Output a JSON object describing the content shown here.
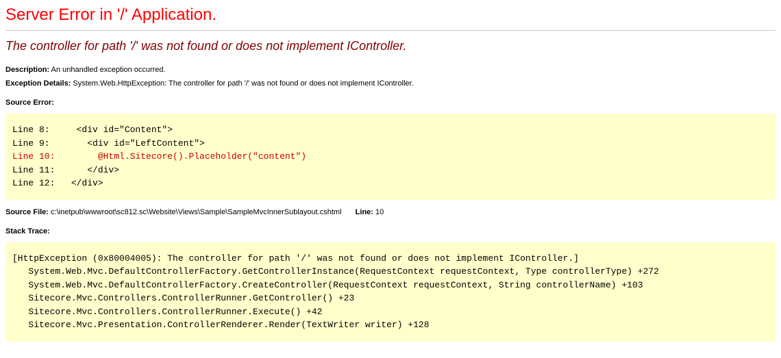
{
  "title": "Server Error in '/' Application.",
  "subtitle": "The controller for path '/' was not found or does not implement IController.",
  "description": {
    "label": "Description:",
    "text": "An unhandled exception occurred."
  },
  "exceptionDetails": {
    "label": "Exception Details:",
    "text": "System.Web.HttpException: The controller for path '/' was not found or does not implement IController."
  },
  "sourceError": {
    "label": "Source Error:",
    "lines": [
      "Line 8:     <div id=\"Content\">",
      "Line 9:       <div id=\"LeftContent\">",
      "Line 10:        @Html.Sitecore().Placeholder(\"content\")",
      "Line 11:      </div>",
      "Line 12:   </div>"
    ],
    "highlightIndex": 2
  },
  "sourceFile": {
    "label": "Source File:",
    "path": "c:\\inetpub\\wwwroot\\sc812.sc\\Website\\Views\\Sample\\SampleMvcInnerSublayout.cshtml",
    "lineLabel": "Line:",
    "lineNumber": "10"
  },
  "stackTrace": {
    "label": "Stack Trace:",
    "content": "[HttpException (0x80004005): The controller for path '/' was not found or does not implement IController.]\n   System.Web.Mvc.DefaultControllerFactory.GetControllerInstance(RequestContext requestContext, Type controllerType) +272\n   System.Web.Mvc.DefaultControllerFactory.CreateController(RequestContext requestContext, String controllerName) +103\n   Sitecore.Mvc.Controllers.ControllerRunner.GetController() +23\n   Sitecore.Mvc.Controllers.ControllerRunner.Execute() +42\n   Sitecore.Mvc.Presentation.ControllerRenderer.Render(TextWriter writer) +128"
  }
}
